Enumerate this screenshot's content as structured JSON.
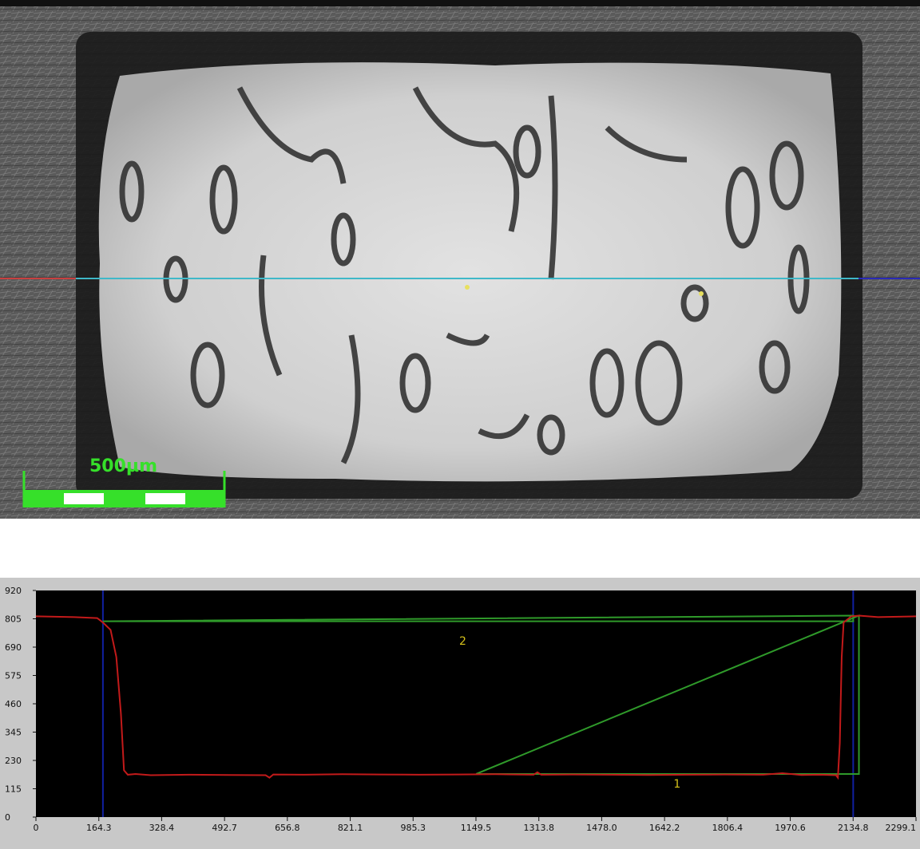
{
  "micrograph": {
    "scale_bar_label": "500µm",
    "scale_bar_color": "#36e02a",
    "profile_line_color": "#3fb8c8"
  },
  "chart_data": {
    "type": "line",
    "title": "",
    "xlabel": "",
    "ylabel": "",
    "xlim": [
      0,
      2299.1
    ],
    "ylim": [
      0,
      920
    ],
    "x_ticks": [
      "0",
      "164.3",
      "328.4",
      "492.7",
      "656.8",
      "821.1",
      "985.3",
      "1149.5",
      "1313.8",
      "1478.0",
      "1642.2",
      "1806.4",
      "1970.6",
      "2134.8",
      "2299.1"
    ],
    "y_ticks": [
      "0",
      "115",
      "230",
      "345",
      "460",
      "575",
      "690",
      "805",
      "920"
    ],
    "background": "#000000",
    "grid": false,
    "series": [
      {
        "color": "#c21a1a",
        "x": [
          0,
          100,
          160,
          175,
          195,
          210,
          222,
          230,
          240,
          260,
          300,
          400,
          500,
          600,
          610,
          620,
          700,
          800,
          900,
          1000,
          1100,
          1200,
          1300,
          1310,
          1320,
          1400,
          1500,
          1600,
          1700,
          1800,
          1900,
          1950,
          2000,
          2050,
          2090,
          2095,
          2100,
          2105,
          2110,
          2130,
          2150,
          2200,
          2299
        ],
        "y": [
          815,
          812,
          808,
          790,
          760,
          650,
          420,
          190,
          172,
          175,
          170,
          172,
          171,
          170,
          160,
          173,
          172,
          174,
          173,
          172,
          173,
          174,
          172,
          182,
          172,
          173,
          172,
          171,
          172,
          173,
          172,
          178,
          171,
          172,
          170,
          160,
          300,
          650,
          790,
          815,
          818,
          812,
          815
        ]
      }
    ],
    "markers": {
      "vertical_lines": [
        {
          "x": 175,
          "color": "#1020a0"
        },
        {
          "x": 2135,
          "color": "#1020a0"
        }
      ],
      "measure_lines": [
        {
          "label": "1",
          "points": [
            [
              1150,
              175
            ],
            [
              2150,
              175
            ],
            [
              2150,
              818
            ],
            [
              1150,
              175
            ]
          ],
          "color": "#2f9a2a"
        },
        {
          "label": "2",
          "points": [
            [
              175,
              795
            ],
            [
              2135,
              818
            ],
            [
              2135,
              795
            ],
            [
              175,
              795
            ]
          ],
          "color": "#2f9a2a"
        }
      ]
    },
    "annotations": [
      {
        "text": "2",
        "x": 1115,
        "y": 700
      },
      {
        "text": "1",
        "x": 1675,
        "y": 120
      }
    ]
  }
}
